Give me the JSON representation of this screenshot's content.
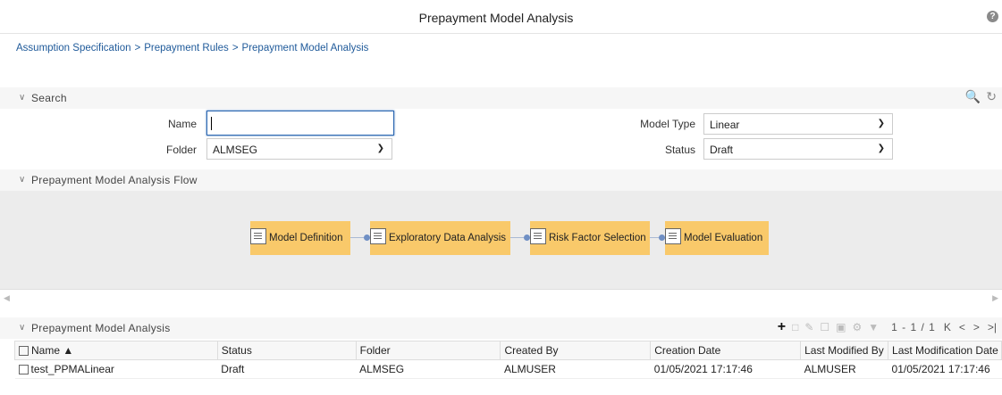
{
  "header": {
    "title": "Prepayment Model Analysis",
    "help_icon": "?"
  },
  "breadcrumb": [
    "Assumption Specification",
    "Prepayment Rules",
    "Prepayment Model Analysis"
  ],
  "breadcrumb_sep": ">",
  "search": {
    "section_label": "Search",
    "name_label": "Name",
    "name_value": "",
    "folder_label": "Folder",
    "folder_value": "ALMSEG",
    "model_type_label": "Model Type",
    "model_type_value": "Linear",
    "status_label": "Status",
    "status_value": "Draft"
  },
  "flow": {
    "section_label": "Prepayment Model Analysis Flow",
    "steps": [
      "Model Definition",
      "Exploratory Data Analysis",
      "Risk Factor Selection",
      "Model Evaluation"
    ]
  },
  "list": {
    "section_label": "Prepayment Model Analysis",
    "pagination": "1 - 1 / 1",
    "columns": [
      "Name",
      "Status",
      "Folder",
      "Created By",
      "Creation Date",
      "Last Modified By",
      "Last Modification Date"
    ],
    "sort_indicator": "▲",
    "rows": [
      [
        "test_PPMALinear",
        "Draft",
        "ALMSEG",
        "ALMUSER",
        "01/05/2021 17:17:46",
        "ALMUSER",
        "01/05/2021 17:17:46"
      ]
    ]
  }
}
